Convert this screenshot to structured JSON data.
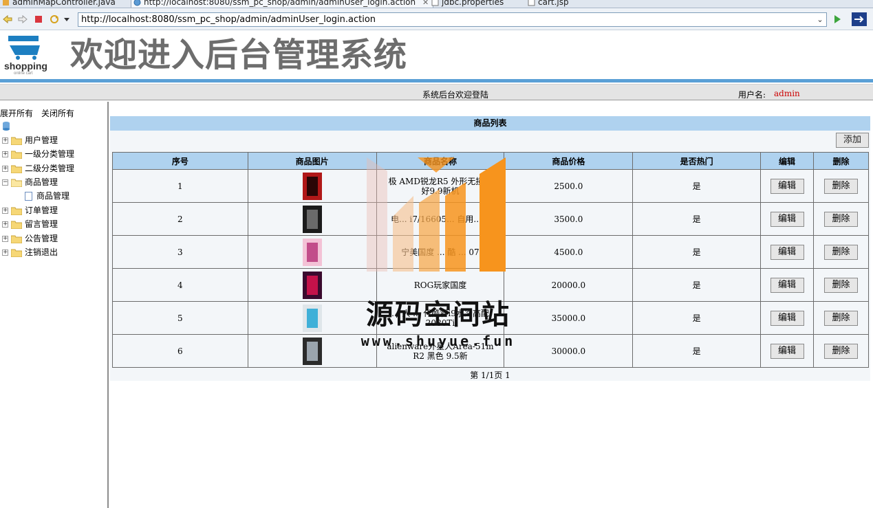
{
  "editor_tabs": [
    {
      "label": "adminMapController.java",
      "active": false
    },
    {
      "label": "http://localhost:8080/ssm_pc_shop/admin/adminUser_login.action",
      "active": true
    },
    {
      "label": "jdbc.properties",
      "active": false
    },
    {
      "label": "cart.jsp",
      "active": false
    }
  ],
  "browser": {
    "url": "http://localhost:8080/ssm_pc_shop/admin/adminUser_login.action"
  },
  "header": {
    "logo_text": "shopping",
    "logo_sub": "online cart",
    "banner": "欢迎进入后台管理系统",
    "welcome": "系统后台欢迎登陆",
    "user_label": "用户名:",
    "username": "admin"
  },
  "tree": {
    "expand_all": "展开所有",
    "collapse_all": "关闭所有",
    "nodes": [
      {
        "label": "用户管理",
        "expanded": false
      },
      {
        "label": "一级分类管理",
        "expanded": false
      },
      {
        "label": "二级分类管理",
        "expanded": false
      },
      {
        "label": "商品管理",
        "expanded": true
      },
      {
        "label": "订单管理",
        "expanded": false
      },
      {
        "label": "留言管理",
        "expanded": false
      },
      {
        "label": "公告管理",
        "expanded": false
      },
      {
        "label": "注销退出",
        "expanded": false
      }
    ],
    "child": "商品管理"
  },
  "main": {
    "title": "商品列表",
    "add_label": "添加",
    "columns": [
      "序号",
      "商品图片",
      "商品名称",
      "商品价格",
      "是否热门",
      "编辑",
      "删除"
    ],
    "rows": [
      {
        "no": "1",
        "name": "极 AMD锐龙R5 外形无损僟 好9.9新机",
        "price": "2500.0",
        "hot": "是",
        "edit": "编辑",
        "del": "删除",
        "img": "red-tower"
      },
      {
        "no": "2",
        "name": "电... i7/16605... 自用...新",
        "price": "3500.0",
        "hot": "是",
        "edit": "编辑",
        "del": "删除",
        "img": "black-tower"
      },
      {
        "no": "3",
        "name": "宁美国度 ... 酷 ... 07",
        "price": "4500.0",
        "hot": "是",
        "edit": "编辑",
        "del": "删除",
        "img": "pink-tower"
      },
      {
        "no": "4",
        "name": "ROG玩家国度",
        "price": "20000.0",
        "hot": "是",
        "edit": "编辑",
        "del": "删除",
        "img": "rog-box"
      },
      {
        "no": "5",
        "name": "... 人 ... 代酷睿i9水冷高配2080Ti",
        "price": "35000.0",
        "hot": "是",
        "edit": "编辑",
        "del": "删除",
        "img": "white-tower"
      },
      {
        "no": "6",
        "name": "alienware外星人Area-51m R2 黑色 9.5新",
        "price": "30000.0",
        "hot": "是",
        "edit": "编辑",
        "del": "删除",
        "img": "laptop"
      }
    ],
    "pager": "第 1/1页 1"
  },
  "watermark": {
    "title": "源码空间站",
    "url": "www.shuyue.fun"
  },
  "colors": {
    "accent_blue": "#5aa0d6",
    "header_blue": "#afd2ef",
    "username_red": "#cc0000",
    "watermark_orange": "#f7941d"
  }
}
